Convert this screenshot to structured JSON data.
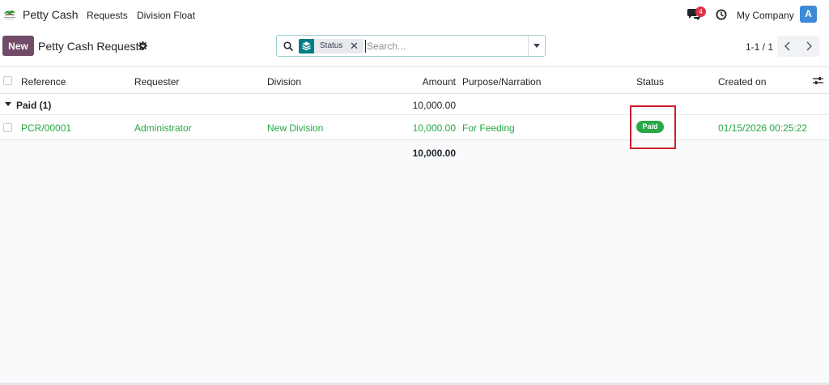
{
  "navbar": {
    "app_name": "Petty Cash",
    "menu": [
      "Requests",
      "Division Float"
    ],
    "messages_count": "4",
    "company": "My Company",
    "avatar_initial": "A"
  },
  "control_panel": {
    "new_label": "New",
    "title": "Petty Cash Requests",
    "search": {
      "facet_value": "Status",
      "facet_remove": "✕",
      "placeholder": "Search..."
    },
    "pager": "1-1 / 1"
  },
  "list": {
    "columns": [
      "Reference",
      "Requester",
      "Division",
      "Amount",
      "Purpose/Narration",
      "Status",
      "Created on"
    ],
    "group": {
      "label": "Paid (1)",
      "amount": "10,000.00"
    },
    "rows": [
      {
        "reference": "PCR/00001",
        "requester": "Administrator",
        "division": "New Division",
        "amount": "10,000.00",
        "purpose": "For Feeding",
        "status": "Paid",
        "created_on": "01/15/2026 00:25:22"
      }
    ],
    "total": "10,000.00"
  },
  "colors": {
    "primary": "#714b67",
    "accent": "#017e84",
    "status_paid": "#28a745",
    "badge_red": "#d9344a",
    "highlight": "#d0202b"
  }
}
